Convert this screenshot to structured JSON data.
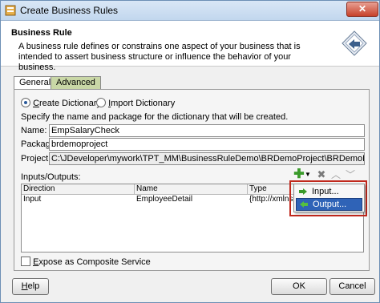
{
  "window": {
    "title": "Create Business Rules",
    "close_glyph": "✕"
  },
  "header": {
    "title": "Business Rule",
    "description": "A business rule defines or constrains one aspect of your business that is intended to assert business structure or influence the behavior of your business."
  },
  "tabs": [
    {
      "label": "General",
      "selected": true
    },
    {
      "label": "Advanced",
      "selected": false
    }
  ],
  "dictionary": {
    "create_option": {
      "label_first": "C",
      "label_rest": "reate Dictionary",
      "selected": true
    },
    "import_option": {
      "label_first": "I",
      "label_rest": "mport Dictionary",
      "selected": false
    },
    "instructions": "Specify the name and package for the dictionary that will be created.",
    "name": {
      "label": "Name:",
      "value": "EmpSalaryCheck"
    },
    "package": {
      "label": "Package:",
      "value": "brdemoproject"
    },
    "project": {
      "label": "Project:",
      "value": "C:\\JDeveloper\\mywork\\TPT_MM\\BusinessRuleDemo\\BRDemoProject\\BRDemoProject.jpr"
    }
  },
  "inputs_outputs": {
    "label": "Inputs/Outputs:",
    "columns": [
      "Direction",
      "Name",
      "Type"
    ],
    "rows": [
      {
        "direction": "Input",
        "name": "EmployeeDetail",
        "type": "{http://xmlns.or"
      }
    ],
    "toolbar_icons": [
      "add-icon",
      "dropdown-arrow-icon",
      "delete-icon",
      "move-up-icon",
      "move-down-icon"
    ]
  },
  "add_menu": {
    "items": [
      {
        "label": "Input...",
        "icon": "input-arrow-icon",
        "selected": false
      },
      {
        "label": "Output...",
        "icon": "output-arrow-icon",
        "selected": true
      }
    ]
  },
  "expose_service": {
    "label_first": "E",
    "label_rest": "xpose as Composite Service",
    "checked": false
  },
  "buttons": {
    "help_first": "H",
    "help_rest": "elp",
    "ok": "OK",
    "cancel": "Cancel"
  },
  "colors": {
    "highlight_box": "#c0281c",
    "menu_selected": "#2f63b7",
    "add_icon": "#3a9a2a"
  }
}
